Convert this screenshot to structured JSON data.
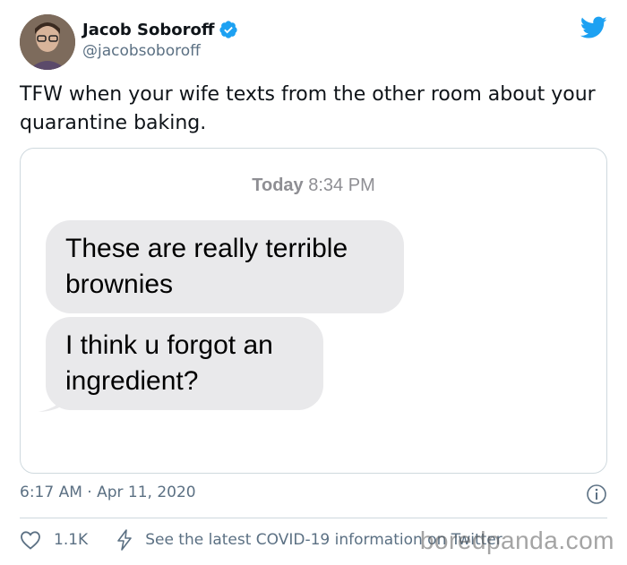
{
  "author": {
    "name": "Jacob Soboroff",
    "handle": "@jacobsoboroff"
  },
  "tweet": {
    "text": "TFW when your wife texts from the other room about your quarantine baking."
  },
  "media": {
    "time_day": "Today",
    "time_clock": "8:34 PM",
    "messages": [
      "These are really terrible brownies",
      "I think u forgot an ingredient?"
    ]
  },
  "meta": {
    "timestamp": "6:17 AM · Apr 11, 2020"
  },
  "actions": {
    "likes": "1.1K",
    "covid_link": "See the latest COVID-19 information on Twitter"
  },
  "watermark": "boredpanda.com",
  "colors": {
    "twitter_blue": "#1da1f2",
    "secondary_text": "#5b7083",
    "bubble_gray": "#e9e9eb"
  },
  "icons": [
    "verified-badge-icon",
    "twitter-bird-icon",
    "info-icon",
    "heart-icon",
    "lightning-bolt-icon"
  ]
}
